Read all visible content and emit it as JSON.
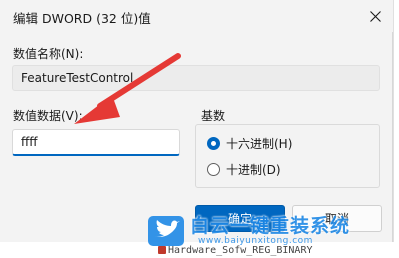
{
  "dialog": {
    "title": "编辑 DWORD (32 位)值",
    "value_name_label": "数值名称(N):",
    "value_name": "FeatureTestControl",
    "value_data_label": "数值数据(V):",
    "value_data": "ffff",
    "base_label": "基数",
    "base_options": [
      {
        "label": "十六进制(H)",
        "checked": true
      },
      {
        "label": "十进制(D)",
        "checked": false
      }
    ],
    "ok_label": "确定",
    "cancel_label": "取消"
  },
  "background": {
    "partial_text": "Hardware_Sofw_REG_BINARY"
  },
  "watermark": {
    "title": "白云一键重装系统",
    "url": "www.baiyunxitong.com"
  },
  "colors": {
    "accent": "#0067c0",
    "annotation_arrow": "#e53935",
    "watermark": "#1e88e5"
  }
}
